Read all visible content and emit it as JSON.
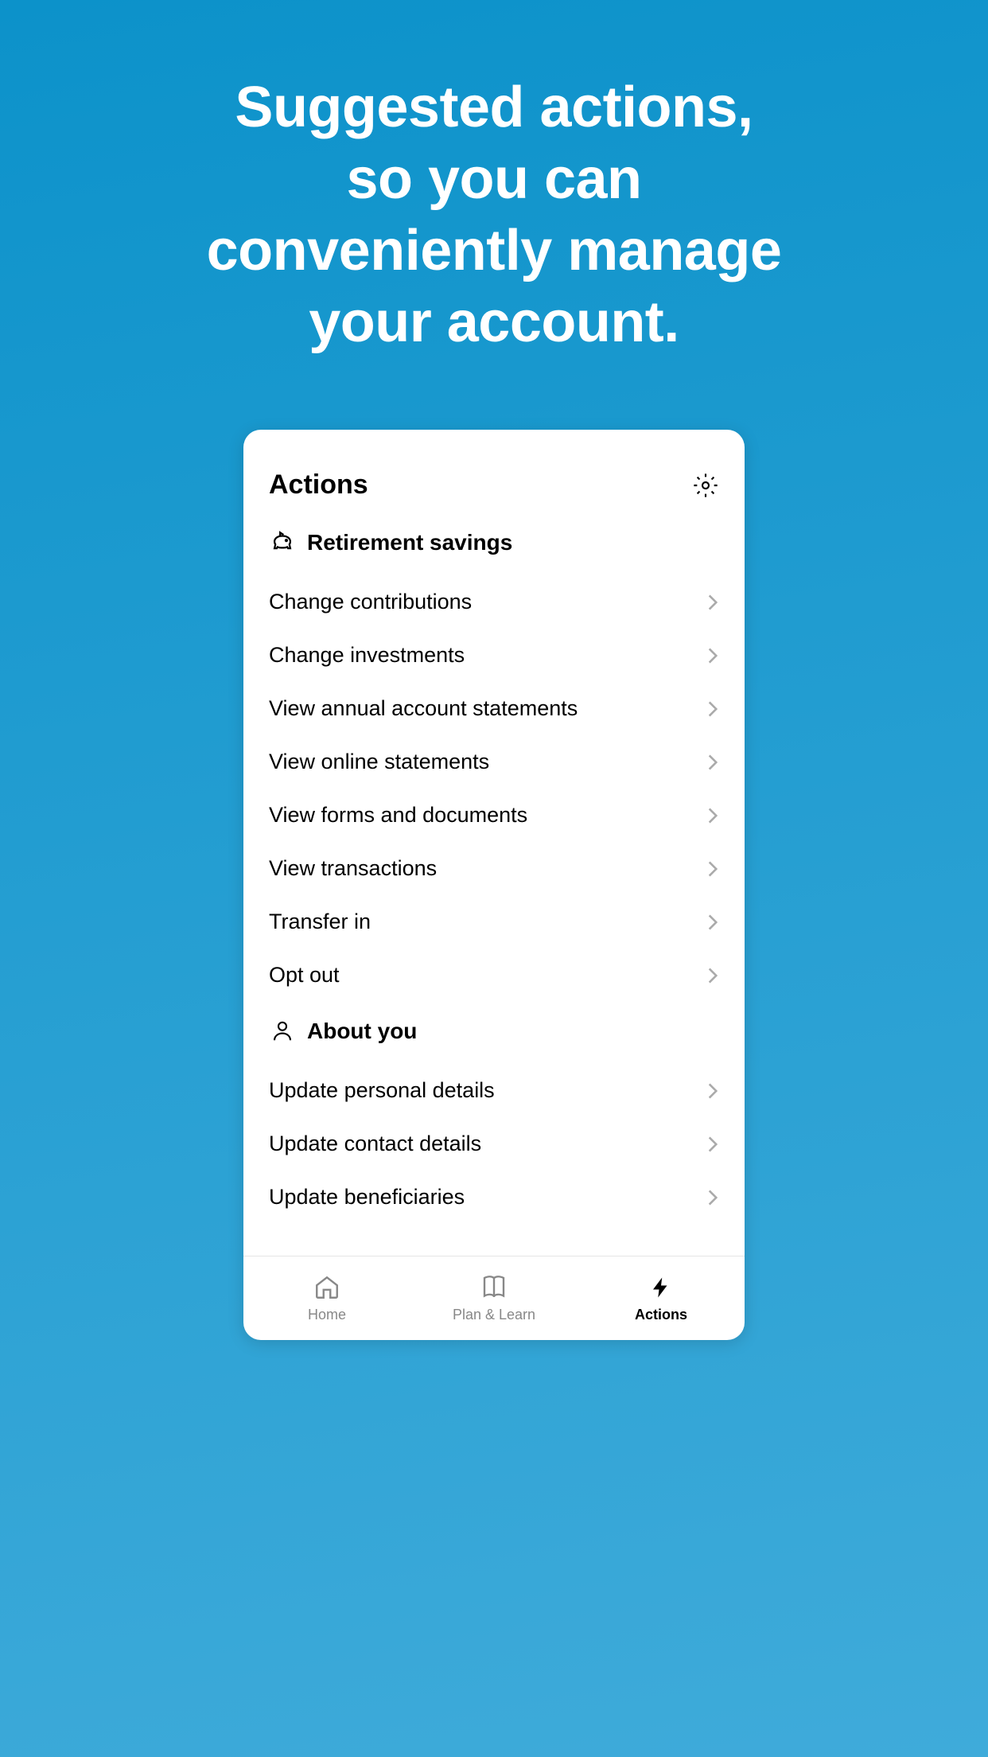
{
  "hero": {
    "title": "Suggested actions,\nso you can\nconveniently manage\nyour account."
  },
  "card": {
    "title": "Actions"
  },
  "sections": {
    "retirement": {
      "title": "Retirement savings",
      "items": [
        {
          "label": "Change contributions"
        },
        {
          "label": "Change investments"
        },
        {
          "label": "View annual account statements"
        },
        {
          "label": "View online statements"
        },
        {
          "label": "View forms and documents"
        },
        {
          "label": "View transactions"
        },
        {
          "label": "Transfer in"
        },
        {
          "label": "Opt out"
        }
      ]
    },
    "about": {
      "title": "About you",
      "items": [
        {
          "label": "Update personal details"
        },
        {
          "label": "Update contact details"
        },
        {
          "label": "Update beneficiaries"
        }
      ]
    }
  },
  "tabs": {
    "home": "Home",
    "plan": "Plan & Learn",
    "actions": "Actions"
  }
}
